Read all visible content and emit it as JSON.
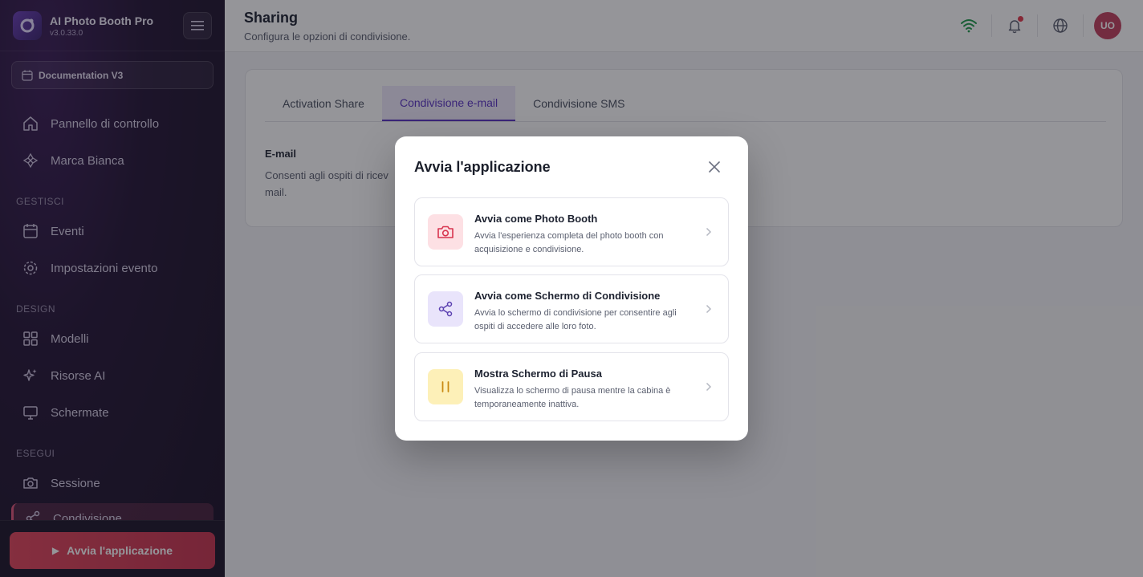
{
  "app": {
    "name": "AI Photo Booth Pro",
    "version": "v3.0.33.0"
  },
  "workspace": {
    "label": "Documentation V3"
  },
  "sidebar": {
    "top_items": [
      {
        "label": "Pannello di controllo",
        "icon": "home-icon"
      },
      {
        "label": "Marca Bianca",
        "icon": "brand-icon"
      }
    ],
    "sections": [
      {
        "label": "GESTISCI",
        "items": [
          {
            "label": "Eventi",
            "icon": "calendar-icon"
          },
          {
            "label": "Impostazioni evento",
            "icon": "gear-icon"
          }
        ]
      },
      {
        "label": "DESIGN",
        "items": [
          {
            "label": "Modelli",
            "icon": "grid-icon"
          },
          {
            "label": "Risorse AI",
            "icon": "sparkles-icon"
          },
          {
            "label": "Schermate",
            "icon": "monitor-icon"
          }
        ]
      },
      {
        "label": "ESEGUI",
        "items": [
          {
            "label": "Sessione",
            "icon": "camera-icon"
          },
          {
            "label": "Condivisione",
            "icon": "share-icon",
            "active": true
          }
        ]
      }
    ],
    "launch_button": "Avvia l'applicazione"
  },
  "header": {
    "title": "Sharing",
    "subtitle": "Configura le opzioni di condivisione.",
    "avatar_initials": "UO",
    "icons": [
      "wifi-icon",
      "bell-icon",
      "globe-icon"
    ]
  },
  "tabs": [
    {
      "label": "Activation Share",
      "active": false
    },
    {
      "label": "Condivisione e-mail",
      "active": true
    },
    {
      "label": "Condivisione SMS",
      "active": false
    }
  ],
  "content": {
    "field_label": "E-mail",
    "field_desc_visible": "Consenti agli ospiti di ricev",
    "field_desc_wrap": "mail."
  },
  "modal": {
    "title": "Avvia l'applicazione",
    "options": [
      {
        "title": "Avvia come Photo Booth",
        "description": "Avvia l'esperienza completa del photo booth con acquisizione e condivisione.",
        "icon": "camera-icon",
        "icon_bg": "#fde0e4",
        "icon_color": "#d8344e"
      },
      {
        "title": "Avvia come Schermo di Condivisione",
        "description": "Avvia lo schermo di condivisione per consentire agli ospiti di accedere alle loro foto.",
        "icon": "share-icon",
        "icon_bg": "#e9e4fb",
        "icon_color": "#5a3fb0"
      },
      {
        "title": "Mostra Schermo di Pausa",
        "description": "Visualizza lo schermo di pausa mentre la cabina è temporaneamente inattiva.",
        "icon": "pause-icon",
        "icon_bg": "#fdf0b8",
        "icon_color": "#c98a12"
      }
    ]
  },
  "colors": {
    "accent": "#5a34c4",
    "launch": "#d63c55",
    "avatar": "#c2405e"
  }
}
